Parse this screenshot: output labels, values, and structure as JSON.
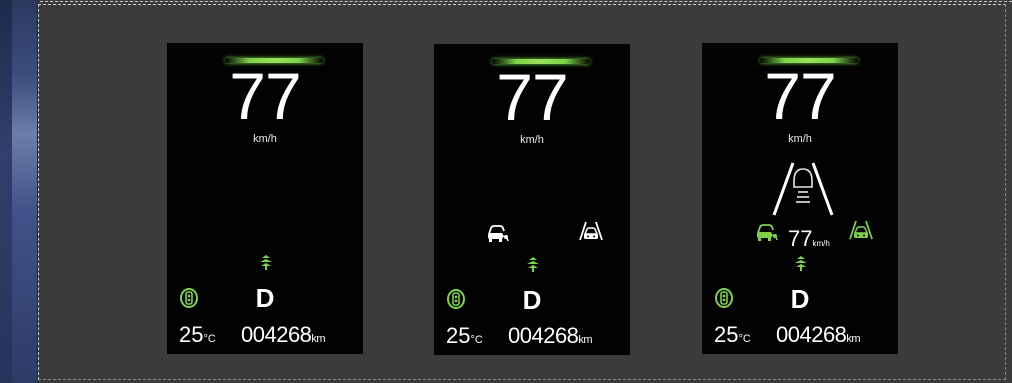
{
  "clusters": [
    {
      "speed": "77",
      "speed_unit": "km/h",
      "gear": "D",
      "temperature": "25",
      "temperature_unit": "°C",
      "odometer": "004268",
      "odometer_unit": "km"
    },
    {
      "speed": "77",
      "speed_unit": "km/h",
      "gear": "D",
      "temperature": "25",
      "temperature_unit": "°C",
      "odometer": "004268",
      "odometer_unit": "km"
    },
    {
      "speed": "77",
      "speed_unit": "km/h",
      "gear": "D",
      "temperature": "25",
      "temperature_unit": "°C",
      "odometer": "004268",
      "odometer_unit": "km",
      "set_speed": "77",
      "set_speed_unit": "km/h"
    }
  ],
  "icons": {
    "speed_bar": "speed-bar-icon",
    "drive_mode": "eco-leaf-icon",
    "ready": "ready-indicator-icon",
    "acc": "adaptive-cruise-icon",
    "lane_keep": "lane-keep-assist-icon",
    "lane_view": "lane-view-icon"
  },
  "colors": {
    "background": "#3b3b3b",
    "panel": "#020202",
    "accent_green": "#7ed24a",
    "text": "#ffffff"
  }
}
